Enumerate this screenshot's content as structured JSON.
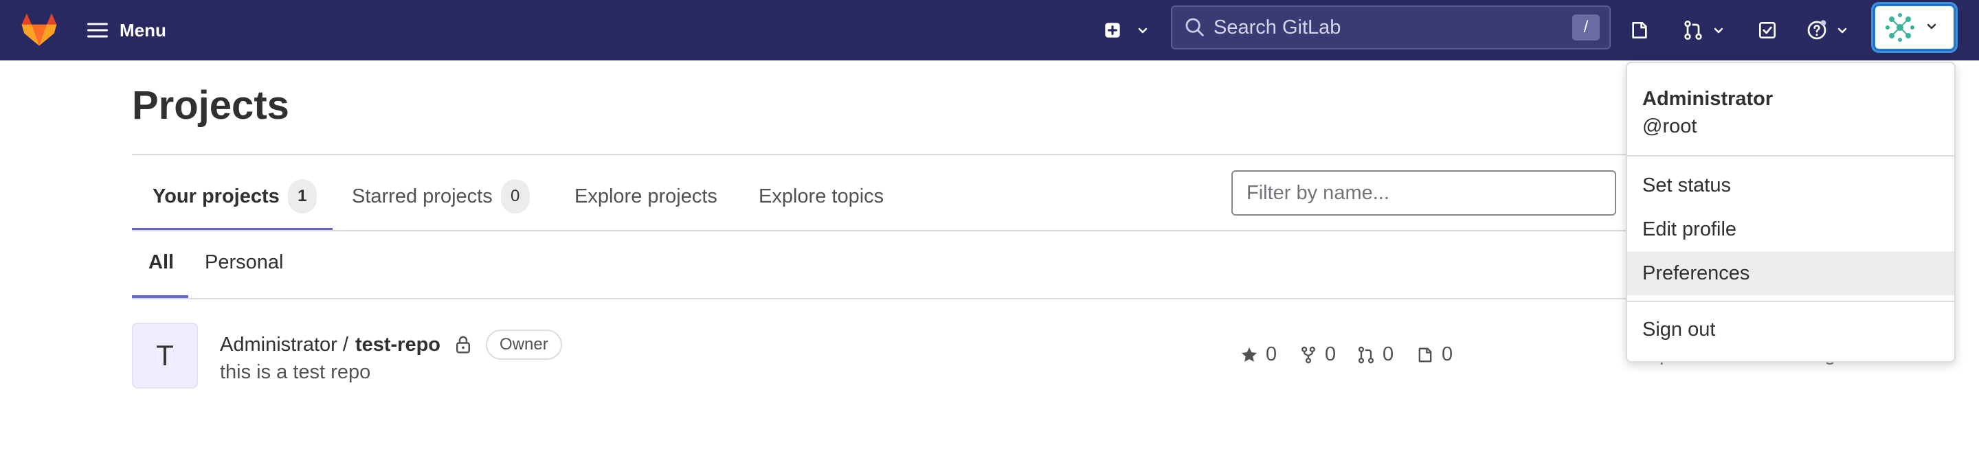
{
  "navbar": {
    "menu_label": "Menu",
    "search_placeholder": "Search GitLab",
    "search_shortcut": "/"
  },
  "page": {
    "title": "Projects",
    "tabs": [
      {
        "label": "Your projects",
        "count": "1"
      },
      {
        "label": "Starred projects",
        "count": "0"
      },
      {
        "label": "Explore projects"
      },
      {
        "label": "Explore topics"
      }
    ],
    "filter_placeholder": "Filter by name...",
    "subtabs": [
      "All",
      "Personal"
    ]
  },
  "project": {
    "avatar_letter": "T",
    "namespace": "Administrator /",
    "name": "test-repo",
    "role": "Owner",
    "description": "this is a test repo",
    "stars": "0",
    "forks": "0",
    "merge_requests": "0",
    "issues": "0",
    "updated": "Updated 2 months ago"
  },
  "user_menu": {
    "name": "Administrator",
    "username": "@root",
    "items": [
      "Set status",
      "Edit profile",
      "Preferences",
      "Sign out"
    ]
  },
  "colors": {
    "navbar_bg": "#292961",
    "accent": "#6666c4",
    "focus_ring": "#1f75cb"
  }
}
